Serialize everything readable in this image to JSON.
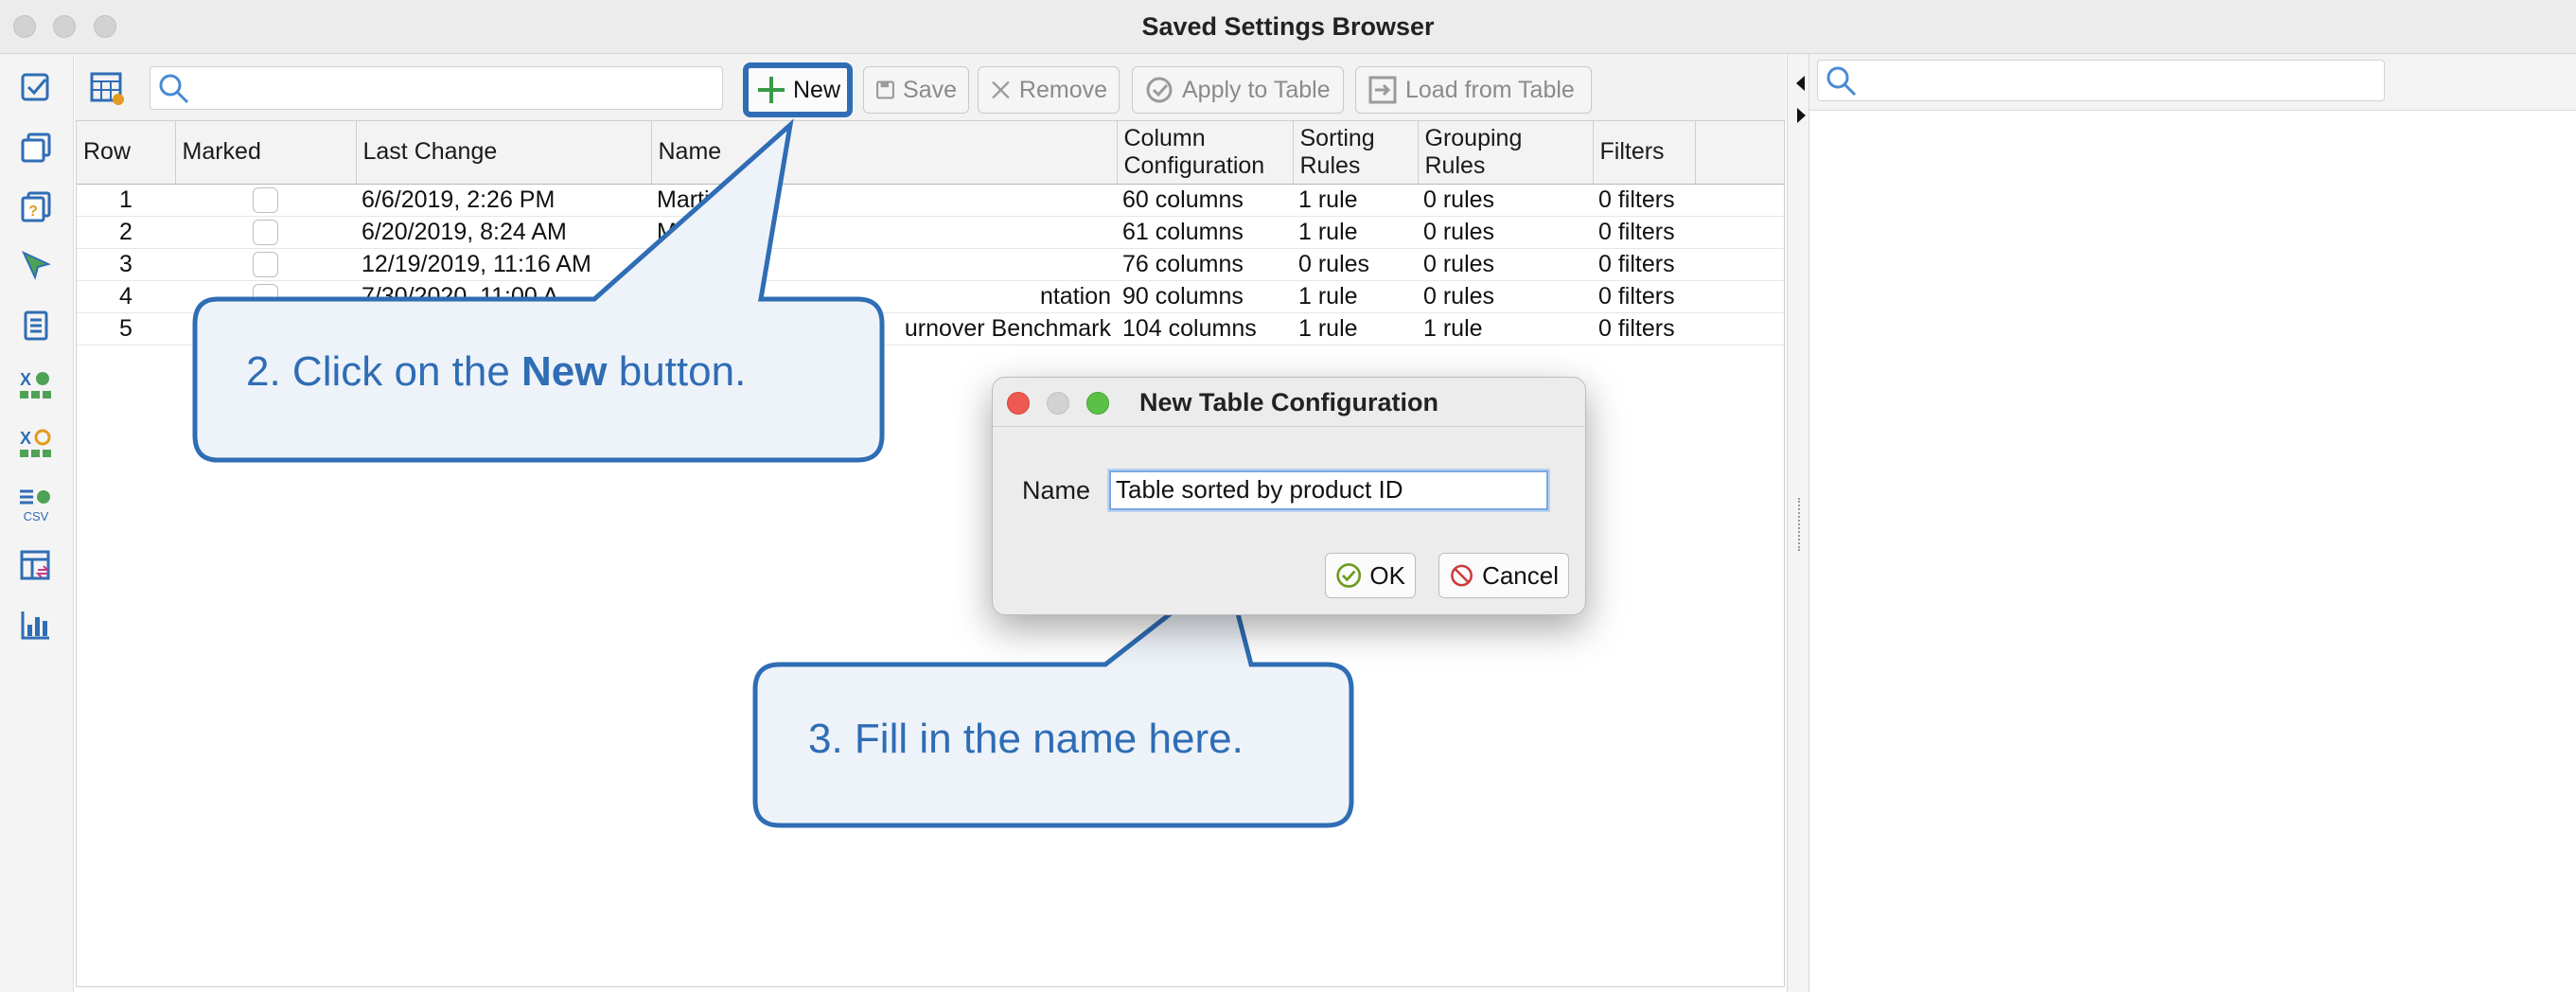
{
  "window": {
    "title": "Saved Settings Browser"
  },
  "toolbar": {
    "search_placeholder": "",
    "new_label": "New",
    "save_label": "Save",
    "remove_label": "Remove",
    "apply_label": "Apply to Table",
    "load_label": "Load from Table"
  },
  "table": {
    "headers": {
      "row": "Row",
      "marked": "Marked",
      "last_change": "Last Change",
      "name": "Name",
      "column_config_1": "Column",
      "column_config_2": "Configuration",
      "sorting_1": "Sorting",
      "sorting_2": "Rules",
      "grouping": "Grouping Rules",
      "filters": "Filters"
    },
    "rows": [
      {
        "row": "1",
        "last_change": "6/6/2019, 2:26 PM",
        "name": "Marti",
        "columns": "60 columns",
        "sorting": "1 rule",
        "grouping": "0 rules",
        "filters": "0 filters"
      },
      {
        "row": "2",
        "last_change": "6/20/2019, 8:24 AM",
        "name": "M",
        "columns": "61 columns",
        "sorting": "1 rule",
        "grouping": "0 rules",
        "filters": "0 filters"
      },
      {
        "row": "3",
        "last_change": "12/19/2019, 11:16 AM",
        "name": "",
        "columns": "76 columns",
        "sorting": "0 rules",
        "grouping": "0 rules",
        "filters": "0 filters"
      },
      {
        "row": "4",
        "last_change": "7/30/2020, 11:00 A",
        "name": "ntation",
        "columns": "90 columns",
        "sorting": "1 rule",
        "grouping": "0 rules",
        "filters": "0 filters"
      },
      {
        "row": "5",
        "last_change": "",
        "name": "urnover Benchmark",
        "columns": "104 columns",
        "sorting": "1 rule",
        "grouping": "1 rule",
        "filters": "0 filters"
      }
    ]
  },
  "callouts": {
    "step2_prefix": "2. Click on the ",
    "step2_bold": "New",
    "step2_suffix": " button.",
    "step3": "3. Fill in the name here."
  },
  "dialog": {
    "title": "New Table Configuration",
    "name_label": "Name",
    "name_value": "Table sorted by product ID",
    "ok_label": "OK",
    "cancel_label": "Cancel"
  },
  "colors": {
    "accent": "#2f6db5",
    "callout_fill": "#eef3f9",
    "highlight": "#2f6db5"
  }
}
